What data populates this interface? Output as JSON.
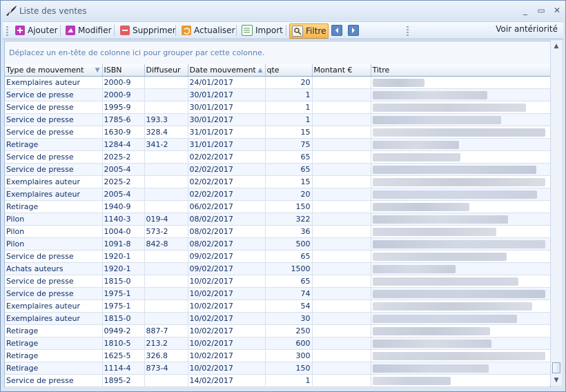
{
  "window": {
    "title": "Liste des ventes",
    "controls": [
      "_",
      "▭",
      "✕"
    ]
  },
  "toolbar": {
    "buttons": [
      {
        "name": "add",
        "label": "Ajouter",
        "icon": "plus-icon",
        "color": "#b93ab5"
      },
      {
        "name": "edit",
        "label": "Modifier",
        "icon": "edit-icon",
        "color": "#b93ab5"
      },
      {
        "name": "delete",
        "label": "Supprimer",
        "icon": "minus-icon",
        "color": "#e45c5c"
      },
      {
        "name": "refresh",
        "label": "Actualiser",
        "icon": "refresh-icon",
        "color": "#e99932"
      },
      {
        "name": "import",
        "label": "Import",
        "icon": "import-icon",
        "color": "#4e9a58"
      },
      {
        "name": "filter",
        "label": "Filtre",
        "icon": "filter-icon",
        "color": "#d9a03b"
      }
    ],
    "history": "Voir antériorité"
  },
  "grid": {
    "group_hint": "Déplacez un en-tête de colonne ici pour grouper par cette colonne.",
    "columns": [
      "Type de mouvement",
      "ISBN",
      "Diffuseur",
      "Date mouvement",
      "qte",
      "Montant €",
      "Titre"
    ],
    "rows": [
      [
        "Exemplaires auteur",
        "2000-9",
        "",
        "24/01/2017",
        "20",
        "",
        ""
      ],
      [
        "Service de presse",
        "2000-9",
        "",
        "30/01/2017",
        "1",
        "",
        ""
      ],
      [
        "Service de presse",
        "1995-9",
        "",
        "30/01/2017",
        "1",
        "",
        ""
      ],
      [
        "Service de presse",
        "1785-6",
        "193.3",
        "30/01/2017",
        "1",
        "",
        ""
      ],
      [
        "Service de presse",
        "1630-9",
        "328.4",
        "31/01/2017",
        "15",
        "",
        ""
      ],
      [
        "Retirage",
        "1284-4",
        "341-2",
        "31/01/2017",
        "75",
        "",
        ""
      ],
      [
        "Service de presse",
        "2025-2",
        "",
        "02/02/2017",
        "65",
        "",
        ""
      ],
      [
        "Service de presse",
        "2005-4",
        "",
        "02/02/2017",
        "65",
        "",
        ""
      ],
      [
        "Exemplaires auteur",
        "2025-2",
        "",
        "02/02/2017",
        "15",
        "",
        ""
      ],
      [
        "Exemplaires auteur",
        "2005-4",
        "",
        "02/02/2017",
        "20",
        "",
        ""
      ],
      [
        "Retirage",
        "1940-9",
        "",
        "06/02/2017",
        "150",
        "",
        ""
      ],
      [
        "Pilon",
        "1140-3",
        "019-4",
        "08/02/2017",
        "322",
        "",
        ""
      ],
      [
        "Pilon",
        "1004-0",
        "573-2",
        "08/02/2017",
        "36",
        "",
        ""
      ],
      [
        "Pilon",
        "1091-8",
        "842-8",
        "08/02/2017",
        "500",
        "",
        ""
      ],
      [
        "Service de presse",
        "1920-1",
        "",
        "09/02/2017",
        "65",
        "",
        ""
      ],
      [
        "Achats auteurs",
        "1920-1",
        "",
        "09/02/2017",
        "1500",
        "",
        ""
      ],
      [
        "Service de presse",
        "1815-0",
        "",
        "10/02/2017",
        "65",
        "",
        ""
      ],
      [
        "Service de presse",
        "1975-1",
        "",
        "10/02/2017",
        "74",
        "",
        ""
      ],
      [
        "Exemplaires auteur",
        "1975-1",
        "",
        "10/02/2017",
        "54",
        "",
        ""
      ],
      [
        "Exemplaires auteur",
        "1815-0",
        "",
        "10/02/2017",
        "30",
        "",
        ""
      ],
      [
        "Retirage",
        "0949-2",
        "887-7",
        "10/02/2017",
        "250",
        "",
        ""
      ],
      [
        "Retirage",
        "1810-5",
        "213.2",
        "10/02/2017",
        "600",
        "",
        ""
      ],
      [
        "Retirage",
        "1625-5",
        "326.8",
        "10/02/2017",
        "300",
        "",
        ""
      ],
      [
        "Retirage",
        "1114-4",
        "873-4",
        "10/02/2017",
        "150",
        "",
        ""
      ],
      [
        "Service de presse",
        "1895-2",
        "",
        "14/02/2017",
        "1",
        "",
        ""
      ]
    ],
    "title_colors": [
      "#c4cad8",
      "#bcc2d0",
      "#c9d0de",
      "#b7bfd0",
      "#d0d5df",
      "#c1c7d5",
      "#cad0dd",
      "#bfc6d5",
      "#cfd4df",
      "#c6ccda"
    ]
  }
}
